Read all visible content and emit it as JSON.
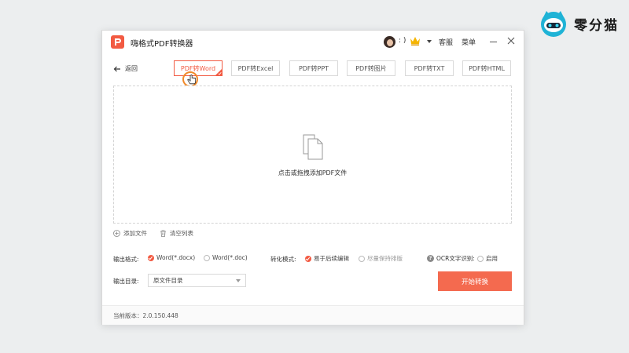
{
  "watermark": {
    "text": "零分猫",
    "icon": "cat-robot-icon"
  },
  "window": {
    "title": "嗨格式PDF转换器",
    "user": {
      "status": ": )",
      "icon": "crown-icon"
    },
    "service_label": "客服",
    "menu_label": "菜单"
  },
  "nav": {
    "back_label": "返回",
    "tabs": [
      {
        "label": "PDF转Word",
        "active": true
      },
      {
        "label": "PDF转Excel",
        "active": false
      },
      {
        "label": "PDF转PPT",
        "active": false
      },
      {
        "label": "PDF转图片",
        "active": false
      },
      {
        "label": "PDF转TXT",
        "active": false
      },
      {
        "label": "PDF转HTML",
        "active": false
      }
    ]
  },
  "dropzone": {
    "text": "点击或拖拽添加PDF文件",
    "icon": "files-icon"
  },
  "file_actions": {
    "add_label": "添加文件",
    "clear_label": "清空列表"
  },
  "options": {
    "format_label": "输出格式:",
    "formats": [
      {
        "label": "Word(*.docx)",
        "selected": true
      },
      {
        "label": "Word(*.doc)",
        "selected": false
      }
    ],
    "mode_label": "转化模式:",
    "modes": [
      {
        "label": "易于后续编辑",
        "selected": true
      },
      {
        "label": "尽量保持排版",
        "selected": false
      }
    ],
    "ocr_label": "OCR文字识别:",
    "ocr_option": {
      "label": "启用",
      "selected": false
    },
    "output_dir_label": "输出目录:",
    "output_dir_value": "原文件目录"
  },
  "start_button": "开始转换",
  "footer": {
    "version": "当前版本：2.0.150.448"
  },
  "colors": {
    "accent": "#f25a42",
    "button": "#f46a4f"
  }
}
